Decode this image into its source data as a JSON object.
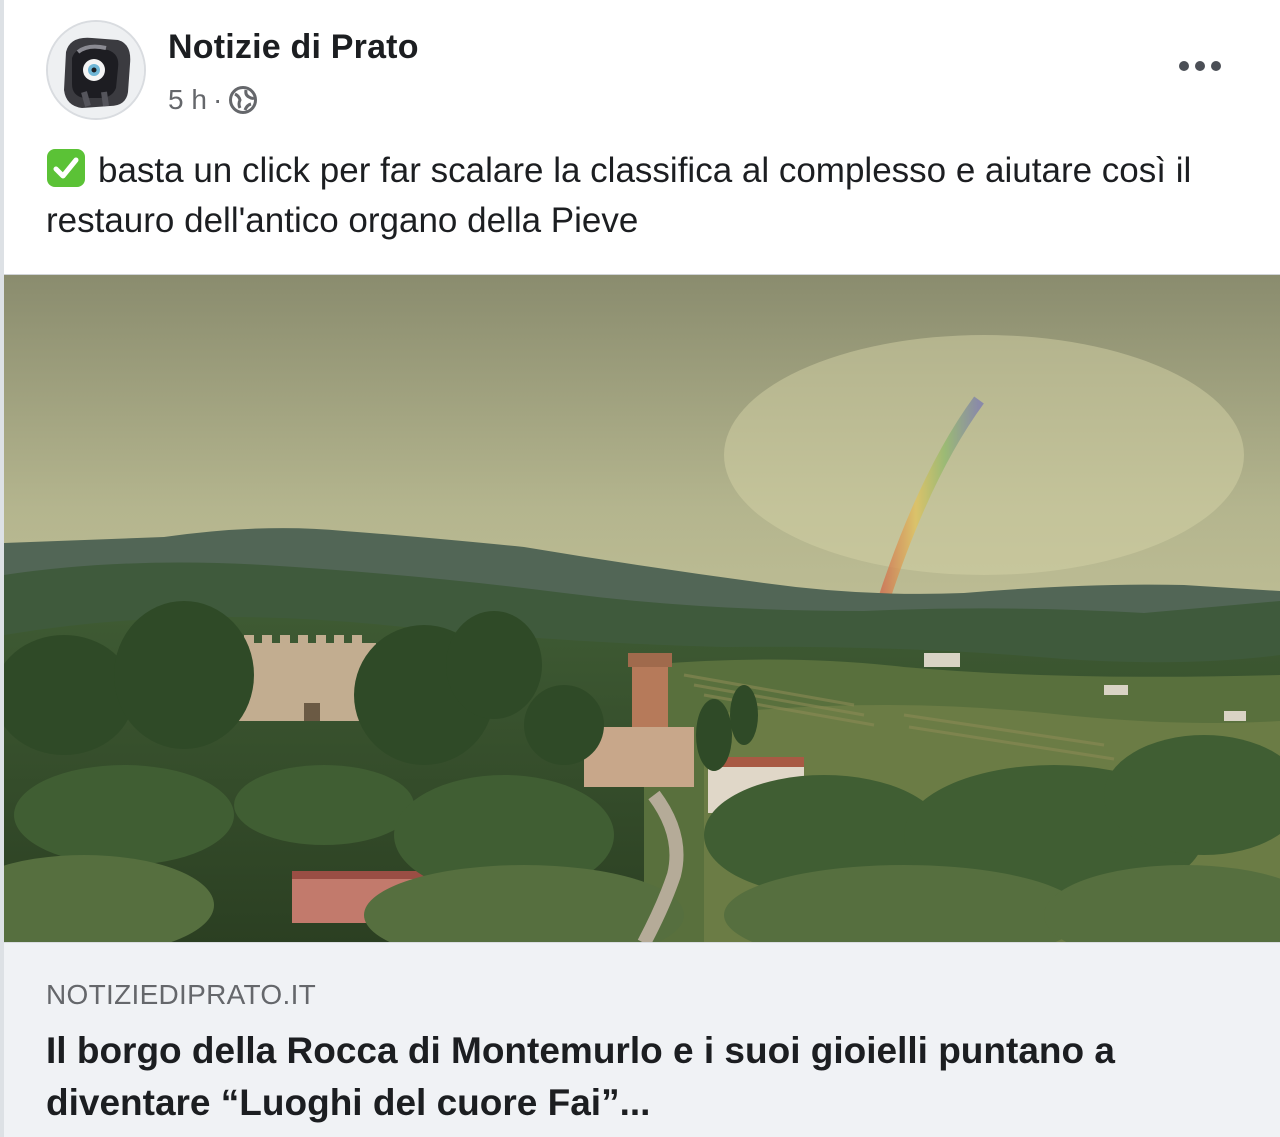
{
  "post": {
    "page_name": "Notizie di Prato",
    "timestamp": "5 h",
    "separator": "·",
    "privacy_icon": "globe-icon",
    "more_icon": "more-horizontal-icon",
    "caption_icon": "white-check-mark-emoji",
    "caption": "basta un click per far scalare la classifica al complesso e aiutare così il restauro dell'antico organo della Pieve"
  },
  "link_preview": {
    "domain": "NOTIZIEDIPRATO.IT",
    "title": "Il borgo della Rocca di Montemurlo e i suoi gioielli puntano a diventare “Luoghi del cuore Fai”..."
  },
  "colors": {
    "text_primary": "#1c1e21",
    "text_secondary": "#65676b",
    "preview_bg": "#f0f2f5",
    "check_green": "#5bc236"
  }
}
